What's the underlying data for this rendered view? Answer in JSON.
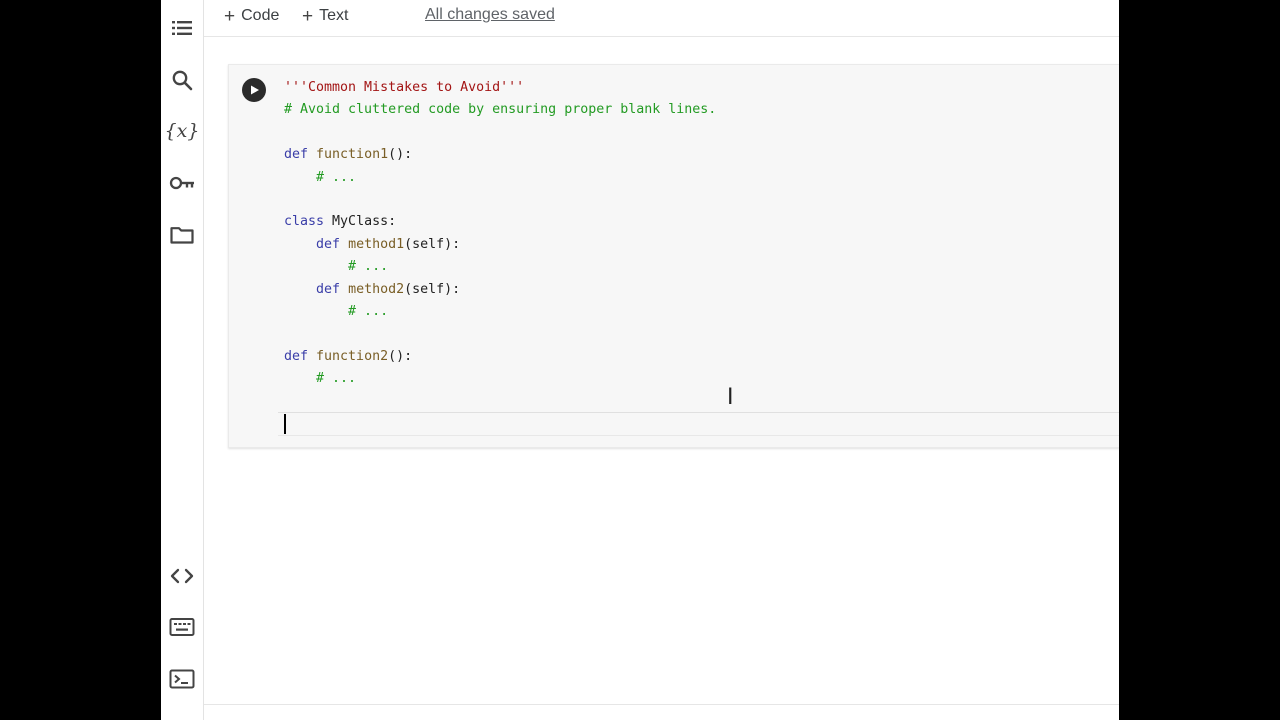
{
  "toolbar": {
    "add_code_label": "Code",
    "add_text_label": "Text",
    "status": "All changes saved"
  },
  "sidebar": {
    "top_icons": [
      "table-of-contents-icon",
      "search-icon",
      "variables-icon",
      "secrets-key-icon",
      "files-folder-icon"
    ],
    "variables_glyph": "{x}",
    "bottom_icons": [
      "code-snippets-icon",
      "command-palette-icon",
      "terminal-icon"
    ]
  },
  "cell": {
    "lines": [
      [
        {
          "t": "'''Common Mistakes to Avoid'''",
          "c": "str"
        }
      ],
      [
        {
          "t": "# Avoid cluttered code by ensuring proper blank lines.",
          "c": "cm"
        }
      ],
      [],
      [
        {
          "t": "def ",
          "c": "kw"
        },
        {
          "t": "function1",
          "c": "fn"
        },
        {
          "t": "():",
          "c": "pl"
        }
      ],
      [
        {
          "t": "    ",
          "c": "pl"
        },
        {
          "t": "# ...",
          "c": "cm"
        }
      ],
      [],
      [
        {
          "t": "class ",
          "c": "kw"
        },
        {
          "t": "MyClass:",
          "c": "pl"
        }
      ],
      [
        {
          "t": "    ",
          "c": "pl"
        },
        {
          "t": "def ",
          "c": "kw"
        },
        {
          "t": "method1",
          "c": "fn"
        },
        {
          "t": "(self):",
          "c": "pl"
        }
      ],
      [
        {
          "t": "        ",
          "c": "pl"
        },
        {
          "t": "# ...",
          "c": "cm"
        }
      ],
      [
        {
          "t": "    ",
          "c": "pl"
        },
        {
          "t": "def ",
          "c": "kw"
        },
        {
          "t": "method2",
          "c": "fn"
        },
        {
          "t": "(self):",
          "c": "pl"
        }
      ],
      [
        {
          "t": "        ",
          "c": "pl"
        },
        {
          "t": "# ...",
          "c": "cm"
        }
      ],
      [],
      [
        {
          "t": "def ",
          "c": "kw"
        },
        {
          "t": "function2",
          "c": "fn"
        },
        {
          "t": "():",
          "c": "pl"
        }
      ],
      [
        {
          "t": "    ",
          "c": "pl"
        },
        {
          "t": "# ...",
          "c": "cm"
        }
      ]
    ]
  }
}
